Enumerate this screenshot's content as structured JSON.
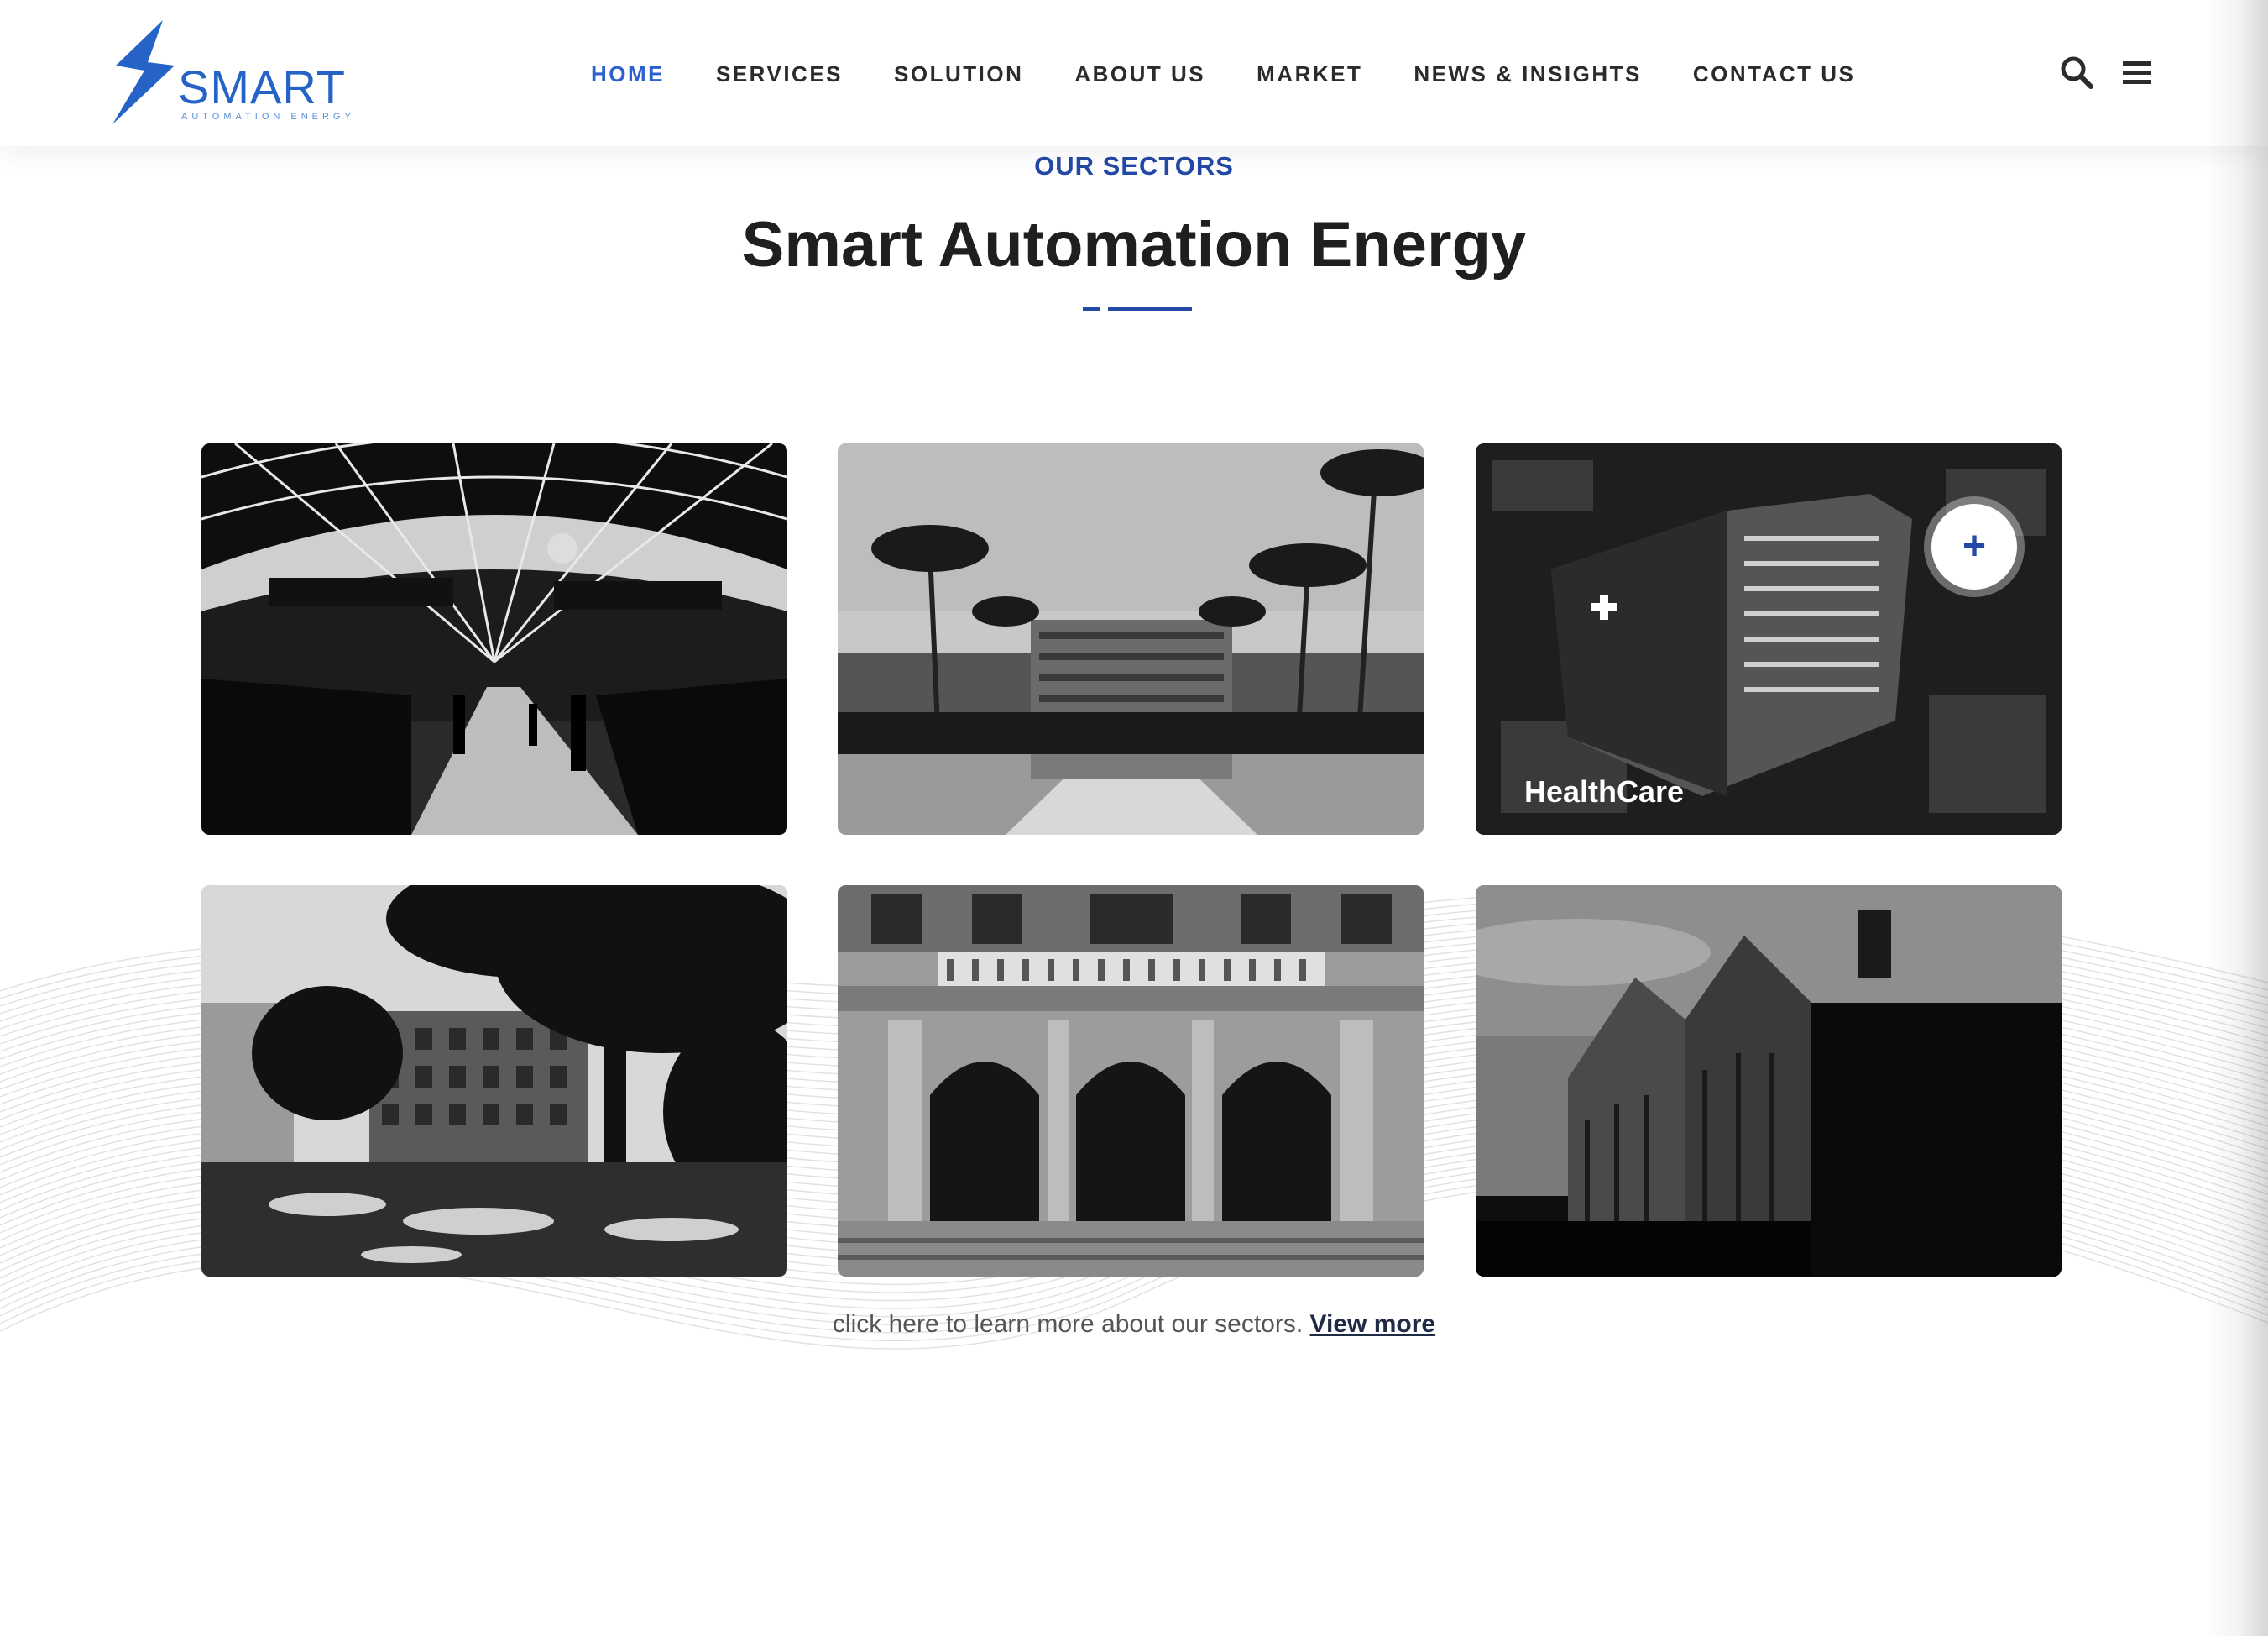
{
  "header": {
    "logo": {
      "word": "SMART",
      "tagline": "AUTOMATION ENERGY",
      "accent": "#2563c6"
    },
    "nav": [
      {
        "label": "HOME",
        "active": true
      },
      {
        "label": "SERVICES",
        "active": false
      },
      {
        "label": "SOLUTION",
        "active": false
      },
      {
        "label": "ABOUT US",
        "active": false
      },
      {
        "label": "MARKET",
        "active": false
      },
      {
        "label": "NEWS & INSIGHTS",
        "active": false
      },
      {
        "label": "CONTACT US",
        "active": false
      }
    ],
    "icons": [
      "search-icon",
      "hamburger-menu-icon"
    ]
  },
  "section": {
    "eyebrow": "OUR SECTORS",
    "title": "Smart Automation Energy",
    "accent": "#2348a6"
  },
  "sectors": [
    {
      "image": "train-station-hall",
      "label": ""
    },
    {
      "image": "resort-with-palms",
      "label": ""
    },
    {
      "image": "hospital-building-night",
      "label": "HealthCare",
      "hover_icon": "plus-icon"
    },
    {
      "image": "campus-building-trees",
      "label": ""
    },
    {
      "image": "classical-facade-arches",
      "label": ""
    },
    {
      "image": "industrial-warehouse",
      "label": ""
    }
  ],
  "cta": {
    "text": "click here to learn more about our sectors.",
    "link": "View more"
  },
  "colors": {
    "nav_active": "#2d5fd0",
    "nav_text": "#2b2b2b",
    "heading": "#1f1f1f"
  }
}
